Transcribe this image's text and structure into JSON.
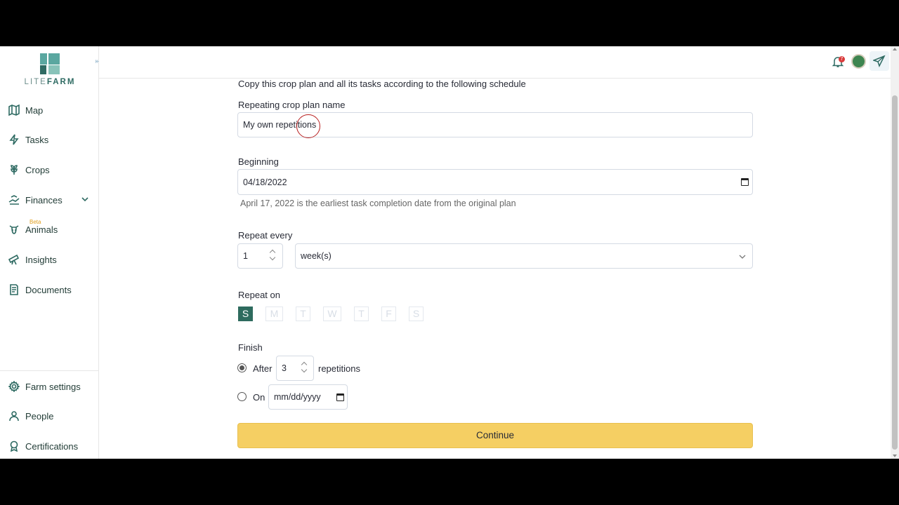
{
  "brand": {
    "logo_prefix": "LITE",
    "logo_suffix": "FARM"
  },
  "header": {
    "notification_count": "7"
  },
  "sidebar": {
    "items": [
      {
        "label": "Map"
      },
      {
        "label": "Tasks"
      },
      {
        "label": "Crops"
      },
      {
        "label": "Finances"
      },
      {
        "label": "Animals",
        "badge": "Beta"
      },
      {
        "label": "Insights"
      },
      {
        "label": "Documents"
      }
    ],
    "bottom_items": [
      {
        "label": "Farm settings"
      },
      {
        "label": "People"
      },
      {
        "label": "Certifications"
      }
    ]
  },
  "form": {
    "intro": "Copy this crop plan and all its tasks according to the following schedule",
    "name_label": "Repeating crop plan name",
    "name_value": "My own repetitions",
    "beginning_label": "Beginning",
    "beginning_value": "04/18/2022",
    "beginning_hint": "April 17, 2022 is the earliest task completion date from the original plan",
    "repeat_every_label": "Repeat every",
    "repeat_every_value": "1",
    "repeat_unit": "week(s)",
    "repeat_on_label": "Repeat on",
    "days": [
      "S",
      "M",
      "T",
      "W",
      "T",
      "F",
      "S"
    ],
    "selected_day_index": 0,
    "finish_label": "Finish",
    "after_label": "After",
    "after_value": "3",
    "repetitions_label": "repetitions",
    "on_label": "On",
    "on_placeholder": "mm/dd/yyyy",
    "finish_mode": "after",
    "continue_label": "Continue"
  }
}
